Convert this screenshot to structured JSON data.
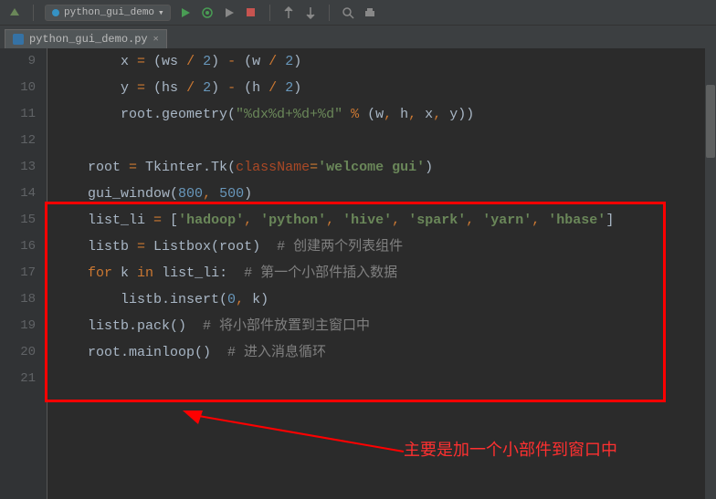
{
  "tab": {
    "filename": "python_gui_demo.py"
  },
  "gutter": {
    "start": 9,
    "end": 21
  },
  "code": {
    "lines": [
      {
        "indent": 2,
        "tokens": [
          [
            "ident",
            "x "
          ],
          [
            "kw",
            "="
          ],
          [
            "ident",
            " (ws "
          ],
          [
            "kw",
            "/"
          ],
          [
            "ident",
            " "
          ],
          [
            "num",
            "2"
          ],
          [
            "ident",
            ") "
          ],
          [
            "kw",
            "-"
          ],
          [
            "ident",
            " (w "
          ],
          [
            "kw",
            "/"
          ],
          [
            "ident",
            " "
          ],
          [
            "num",
            "2"
          ],
          [
            "ident",
            ")"
          ]
        ]
      },
      {
        "indent": 2,
        "tokens": [
          [
            "ident",
            "y "
          ],
          [
            "kw",
            "="
          ],
          [
            "ident",
            " (hs "
          ],
          [
            "kw",
            "/"
          ],
          [
            "ident",
            " "
          ],
          [
            "num",
            "2"
          ],
          [
            "ident",
            ") "
          ],
          [
            "kw",
            "-"
          ],
          [
            "ident",
            " (h "
          ],
          [
            "kw",
            "/"
          ],
          [
            "ident",
            " "
          ],
          [
            "num",
            "2"
          ],
          [
            "ident",
            ")"
          ]
        ]
      },
      {
        "indent": 2,
        "tokens": [
          [
            "ident",
            "root.geometry("
          ],
          [
            "str",
            "\"%dx%d+%d+%d\""
          ],
          [
            "ident",
            " "
          ],
          [
            "kw",
            "%"
          ],
          [
            "ident",
            " (w"
          ],
          [
            "kw",
            ","
          ],
          [
            "ident",
            " h"
          ],
          [
            "kw",
            ","
          ],
          [
            "ident",
            " x"
          ],
          [
            "kw",
            ","
          ],
          [
            "ident",
            " y))"
          ]
        ]
      },
      {
        "indent": 0,
        "tokens": []
      },
      {
        "indent": 1,
        "tokens": [
          [
            "ident",
            "root "
          ],
          [
            "kw",
            "="
          ],
          [
            "ident",
            " Tkinter.Tk("
          ],
          [
            "param",
            "className"
          ],
          [
            "kw",
            "="
          ],
          [
            "bold-str",
            "'welcome gui'"
          ],
          [
            "ident",
            ")"
          ]
        ]
      },
      {
        "indent": 1,
        "tokens": [
          [
            "ident",
            "gui_window("
          ],
          [
            "num",
            "800"
          ],
          [
            "kw",
            ","
          ],
          [
            "ident",
            " "
          ],
          [
            "num",
            "500"
          ],
          [
            "ident",
            ")"
          ]
        ]
      },
      {
        "indent": 1,
        "tokens": [
          [
            "ident",
            "list_li "
          ],
          [
            "kw",
            "="
          ],
          [
            "ident",
            " ["
          ],
          [
            "bold-str",
            "'hadoop'"
          ],
          [
            "kw",
            ","
          ],
          [
            "ident",
            " "
          ],
          [
            "bold-str",
            "'python'"
          ],
          [
            "kw",
            ","
          ],
          [
            "ident",
            " "
          ],
          [
            "bold-str",
            "'hive'"
          ],
          [
            "kw",
            ","
          ],
          [
            "ident",
            " "
          ],
          [
            "bold-str",
            "'spark'"
          ],
          [
            "kw",
            ","
          ],
          [
            "ident",
            " "
          ],
          [
            "bold-str",
            "'yarn'"
          ],
          [
            "kw",
            ","
          ],
          [
            "ident",
            " "
          ],
          [
            "bold-str",
            "'hbase'"
          ],
          [
            "ident",
            "]"
          ]
        ]
      },
      {
        "indent": 1,
        "tokens": [
          [
            "ident",
            "listb "
          ],
          [
            "kw",
            "="
          ],
          [
            "ident",
            " Listbox(root)  "
          ],
          [
            "comment",
            "# 创建两个列表组件"
          ]
        ]
      },
      {
        "indent": 1,
        "tokens": [
          [
            "kw",
            "for"
          ],
          [
            "ident",
            " k "
          ],
          [
            "kw",
            "in"
          ],
          [
            "ident",
            " list_li:  "
          ],
          [
            "comment",
            "# 第一个小部件插入数据"
          ]
        ]
      },
      {
        "indent": 2,
        "tokens": [
          [
            "ident",
            "listb.insert("
          ],
          [
            "num",
            "0"
          ],
          [
            "kw",
            ","
          ],
          [
            "ident",
            " k)"
          ]
        ]
      },
      {
        "indent": 1,
        "tokens": [
          [
            "ident",
            "listb.pack()  "
          ],
          [
            "comment",
            "# 将小部件放置到主窗口中"
          ]
        ]
      },
      {
        "indent": 1,
        "tokens": [
          [
            "ident",
            "root.mainloop()  "
          ],
          [
            "comment",
            "# 进入消息循环"
          ]
        ]
      },
      {
        "indent": 0,
        "tokens": []
      }
    ]
  },
  "annotation": {
    "text": "主要是加一个小部件到窗口中"
  },
  "run_config_label": "python_gui_demo"
}
